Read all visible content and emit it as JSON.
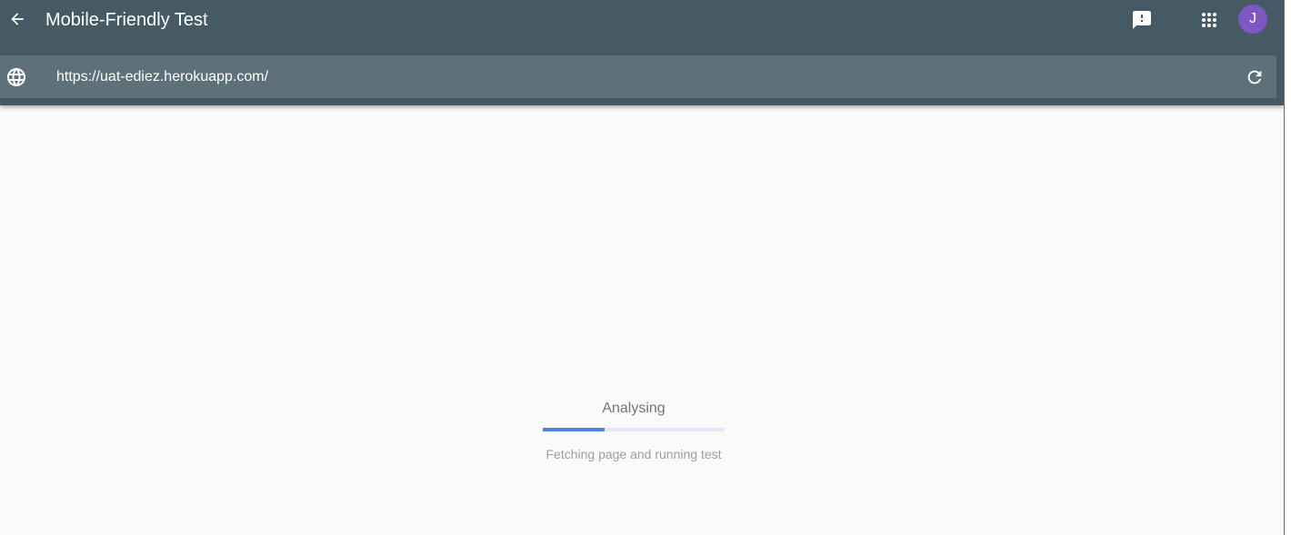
{
  "header": {
    "title": "Mobile-Friendly Test",
    "back_icon": "arrow-back-icon",
    "feedback_icon": "feedback-icon",
    "apps_icon": "apps-grid-icon",
    "avatar_letter": "J",
    "avatar_color": "#7e57c2",
    "bar_color": "#455a64"
  },
  "url_bar": {
    "icon": "globe-icon",
    "value": "https://uat-ediez.herokuapp.com/",
    "refresh_icon": "refresh-icon"
  },
  "loading": {
    "title": "Analysing",
    "subtitle": "Fetching page and running test",
    "progress_percent": 34,
    "accent_color": "#4a86e0"
  }
}
